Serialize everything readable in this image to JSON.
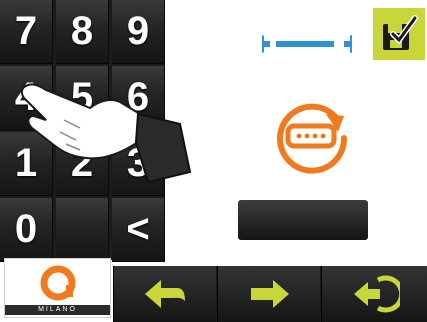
{
  "keypad": {
    "keys": [
      {
        "label": "7"
      },
      {
        "label": "8"
      },
      {
        "label": "9"
      },
      {
        "label": "4"
      },
      {
        "label": "5"
      },
      {
        "label": "6"
      },
      {
        "label": "1"
      },
      {
        "label": "2"
      },
      {
        "label": "3"
      },
      {
        "label": "0"
      },
      {
        "label": ""
      },
      {
        "label": "<"
      }
    ]
  },
  "logo": {
    "brand_text": "MILANO",
    "accent": "#f07a1e"
  },
  "colors": {
    "accent_blue": "#2f8fd8",
    "accent_orange": "#f07a1e",
    "save_green": "#c8d63a"
  },
  "icons": {
    "wrench": "wrench-icon",
    "reset": "reset-code-icon",
    "save": "save-icon",
    "back": "back-arrow-icon",
    "forward": "forward-arrow-icon",
    "exit": "exit-icon",
    "hand": "hand-pointer-icon"
  }
}
